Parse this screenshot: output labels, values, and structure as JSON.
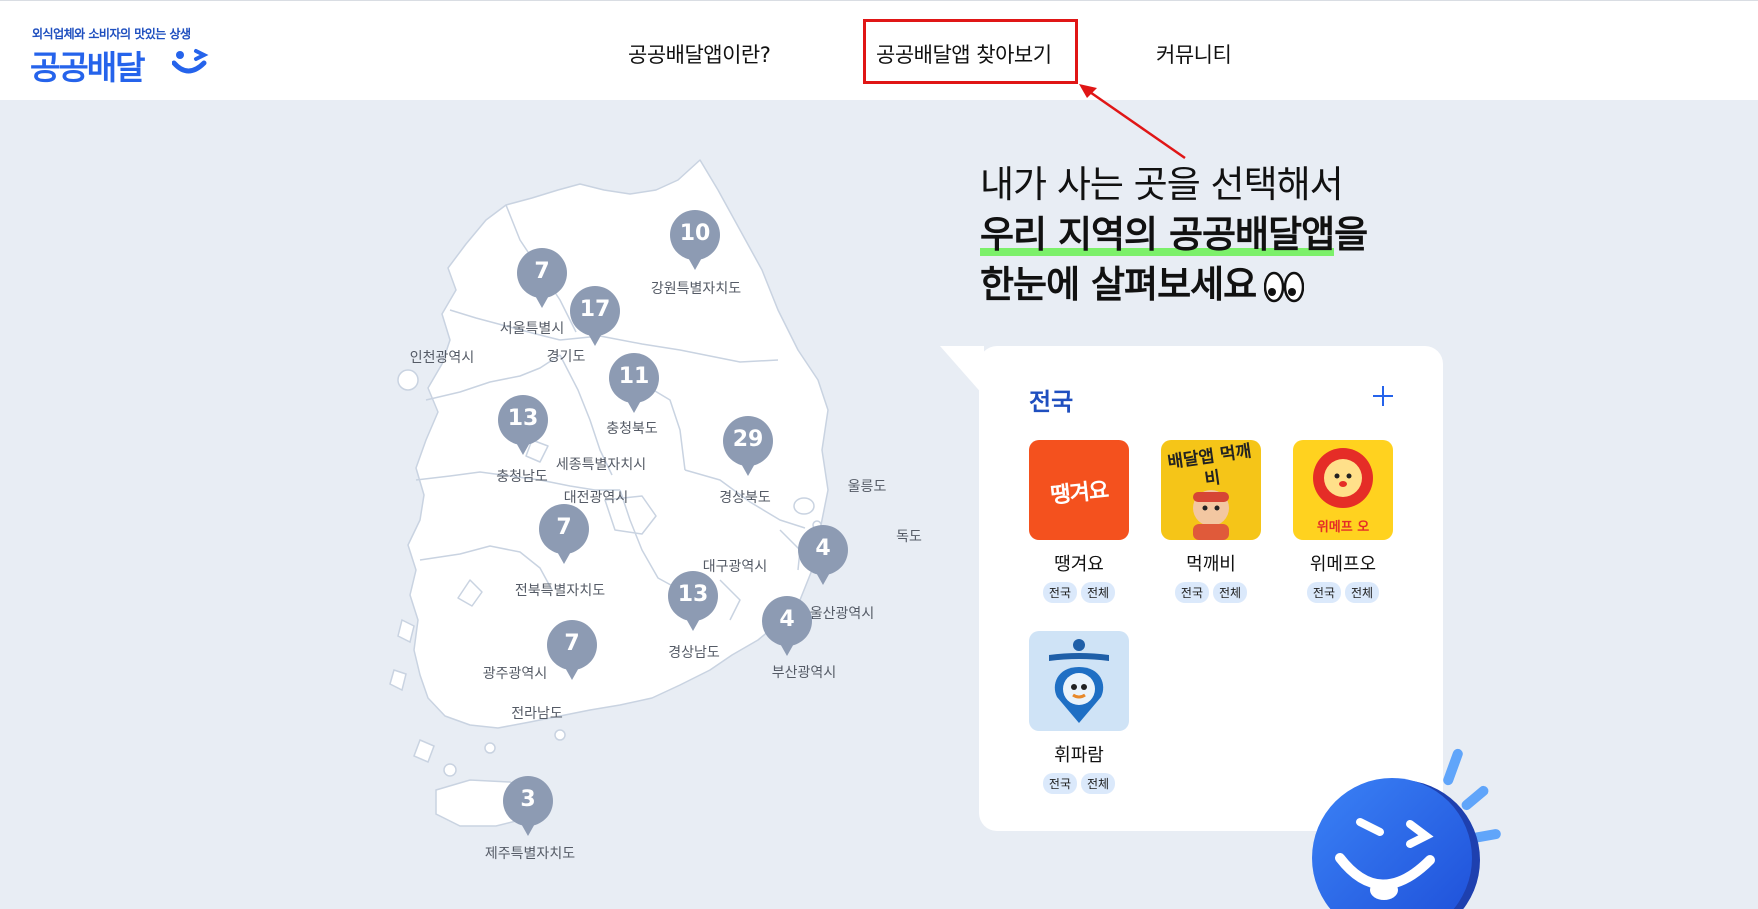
{
  "header": {
    "logo": {
      "tagline": "외식업체와 소비자의 맛있는 상생",
      "name": "공공배달"
    },
    "nav": [
      {
        "label": "공공배달앱이란?"
      },
      {
        "label": "공공배달앱 찾아보기"
      },
      {
        "label": "커뮤니티"
      }
    ],
    "highlight_color": "#e01616"
  },
  "headline": {
    "line1": "내가 사는 곳을 선택해서",
    "line2_highlight": "우리 지역의 공공배달앱",
    "line2_suffix": "을",
    "line3": "한눈에 살펴보세요"
  },
  "map": {
    "regions": [
      {
        "name": "강원특별자치도",
        "count": "10"
      },
      {
        "name": "서울특별시",
        "count": "7"
      },
      {
        "name": "경기도",
        "count": "17"
      },
      {
        "name": "인천광역시"
      },
      {
        "name": "충청북도",
        "count": "11"
      },
      {
        "name": "충청남도",
        "count": "13"
      },
      {
        "name": "세종특별자치시"
      },
      {
        "name": "대전광역시"
      },
      {
        "name": "경상북도",
        "count": "29"
      },
      {
        "name": "울릉도"
      },
      {
        "name": "독도"
      },
      {
        "name": "대구광역시"
      },
      {
        "name": "전북특별자치도",
        "count": "7"
      },
      {
        "name": "울산광역시",
        "count": "4"
      },
      {
        "name": "경상남도",
        "count": "13"
      },
      {
        "name": "부산광역시",
        "count": "4"
      },
      {
        "name": "광주광역시",
        "count": "7"
      },
      {
        "name": "전라남도"
      },
      {
        "name": "제주특별자치도",
        "count": "3"
      }
    ],
    "pin_color": "#8d9bb3"
  },
  "card": {
    "title": "전국",
    "apps": [
      {
        "name": "땡겨요",
        "tags": [
          "전국",
          "전체"
        ],
        "icon": "ddangyo-logo",
        "icon_text": "땡겨요",
        "color": "#f4511e"
      },
      {
        "name": "먹깨비",
        "tags": [
          "전국",
          "전체"
        ],
        "icon": "mukkebi-logo",
        "icon_text": "배달앱 먹깨비",
        "color": "#f5c518"
      },
      {
        "name": "위메프오",
        "tags": [
          "전국",
          "전체"
        ],
        "icon": "wemepo-logo",
        "icon_text": "위메프 오",
        "color": "#ffd21f"
      },
      {
        "name": "휘파람",
        "tags": [
          "전국",
          "전체"
        ],
        "icon": "hwiparam-logo",
        "color": "#cfe3f6"
      }
    ]
  },
  "colors": {
    "brand": "#2563eb",
    "background": "#e8edf4",
    "highlight_underline": "#7cf06a"
  }
}
